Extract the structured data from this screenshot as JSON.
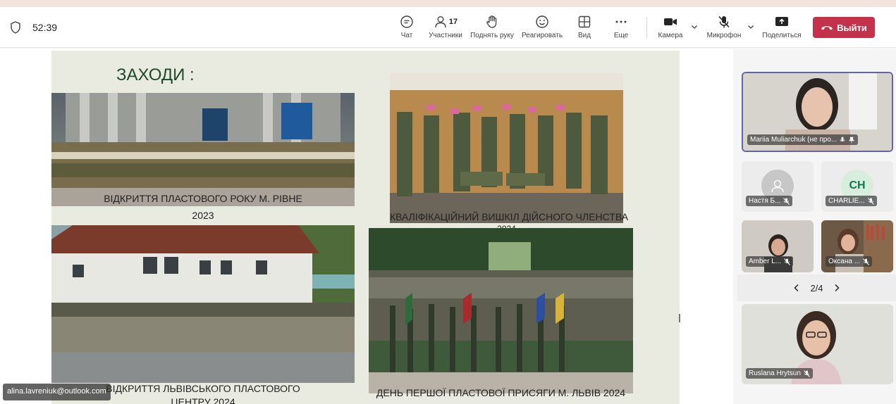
{
  "meeting": {
    "timer": "52:39",
    "participant_count": "17"
  },
  "toolbar": {
    "chat_label": "Чат",
    "participants_label": "Участники",
    "raise_hand_label": "Поднять руку",
    "react_label": "Реагировать",
    "view_label": "Вид",
    "more_label": "Еще",
    "camera_label": "Камера",
    "mic_label": "Микрофон",
    "share_label": "Поделиться",
    "leave_label": "Выйти"
  },
  "slide": {
    "title": "ЗАХОДИ :",
    "captions": {
      "rivne_line1": "ВІДКРИТТЯ ПЛАСТОВОГО РОКУ М. РІВНЕ",
      "rivne_line2": "2023",
      "kvalif_line1": "КВАЛІФІКАЦІЙНИЙ ВИШКІЛ ДІЙСНОГО ЧЛЕНСТВА",
      "kvalif_line2": "2024",
      "lviv_center_line1": "ВІДКРИТТЯ ЛЬВІВСЬКОГО ПЛАСТОВОГО",
      "lviv_center_line2": "ЦЕНТРУ 2024",
      "oath": "ДЕНЬ ПЕРШОЇ ПЛАСТОВОЇ ПРИСЯГИ М. ЛЬВІВ 2024"
    }
  },
  "participants": [
    {
      "name": "Mariia Muliarchuk (не про...",
      "active": true
    },
    {
      "name": "Настя Б...",
      "initials": ""
    },
    {
      "name": "CHARLIE...",
      "initials": "CH"
    },
    {
      "name": "Amber L..."
    },
    {
      "name": "Оксана ..."
    },
    {
      "name": "Ruslana Hrytsun"
    }
  ],
  "pager": {
    "text": "2/4"
  },
  "presenter_email": "alina.lavreniuk@outlook.com",
  "colors": {
    "leave": "#c4314b",
    "active_tile": "#6264a7",
    "slide_bg": "#e9ebe0",
    "title": "#1d4a2a"
  }
}
